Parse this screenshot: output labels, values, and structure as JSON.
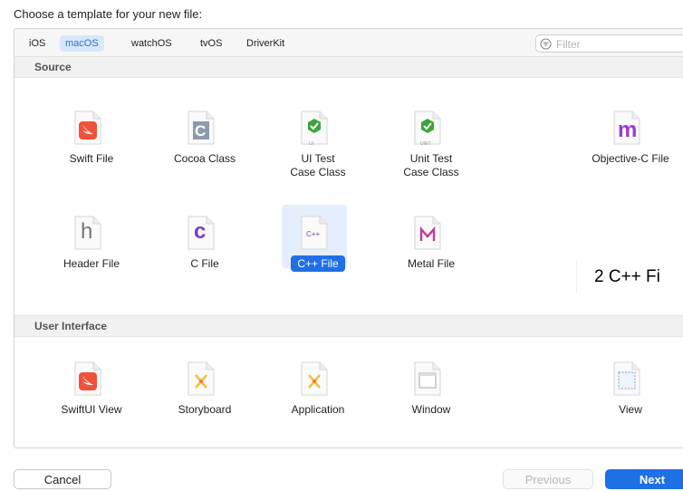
{
  "prompt": "Choose a template for your new file:",
  "tabs": [
    "iOS",
    "macOS",
    "watchOS",
    "tvOS",
    "DriverKit"
  ],
  "selected_tab": "macOS",
  "filter": {
    "placeholder": "Filter",
    "value": ""
  },
  "sections": [
    {
      "title": "Source",
      "items": [
        {
          "label_line1": "Swift File",
          "label_line2": "",
          "icon": "swift-icon"
        },
        {
          "label_line1": "Cocoa Class",
          "label_line2": "",
          "icon": "cocoa-class-icon",
          "glyph": "C"
        },
        {
          "label_line1": "UI Test",
          "label_line2": "Case Class",
          "icon": "ui-test-icon",
          "badge": "UI"
        },
        {
          "label_line1": "Unit Test",
          "label_line2": "Case Class",
          "icon": "unit-test-icon",
          "badge": "UNIT"
        },
        {
          "label_line1": "Objective-C File",
          "label_line2": "",
          "icon": "objc-icon",
          "glyph": "m"
        },
        {
          "label_line1": "Header File",
          "label_line2": "",
          "icon": "header-icon",
          "glyph": "h"
        },
        {
          "label_line1": "C File",
          "label_line2": "",
          "icon": "c-icon",
          "glyph": "c"
        },
        {
          "label_line1": "C++ File",
          "label_line2": "",
          "icon": "cpp-icon",
          "glyph": "C++",
          "selected": true
        },
        {
          "label_line1": "Metal File",
          "label_line2": "",
          "icon": "metal-icon",
          "glyph": "M"
        }
      ]
    },
    {
      "title": "User Interface",
      "items": [
        {
          "label_line1": "SwiftUI View",
          "icon": "swift-icon"
        },
        {
          "label_line1": "Storyboard",
          "icon": "storyboard-icon"
        },
        {
          "label_line1": "Application",
          "icon": "application-icon"
        },
        {
          "label_line1": "Window",
          "icon": "window-icon"
        },
        {
          "label_line1": "View",
          "icon": "view-icon"
        }
      ]
    }
  ],
  "annotation": "2 C++ Fi",
  "buttons": {
    "cancel": "Cancel",
    "previous": "Previous",
    "next": "Next"
  },
  "colors": {
    "accent": "#1f6fe5",
    "selected_tab_bg": "#d9e7fb",
    "swift": "#f0513a",
    "test_green": "#3aa63a",
    "objc_purple": "#9a3bd0",
    "c_purple": "#7a3fc2"
  }
}
